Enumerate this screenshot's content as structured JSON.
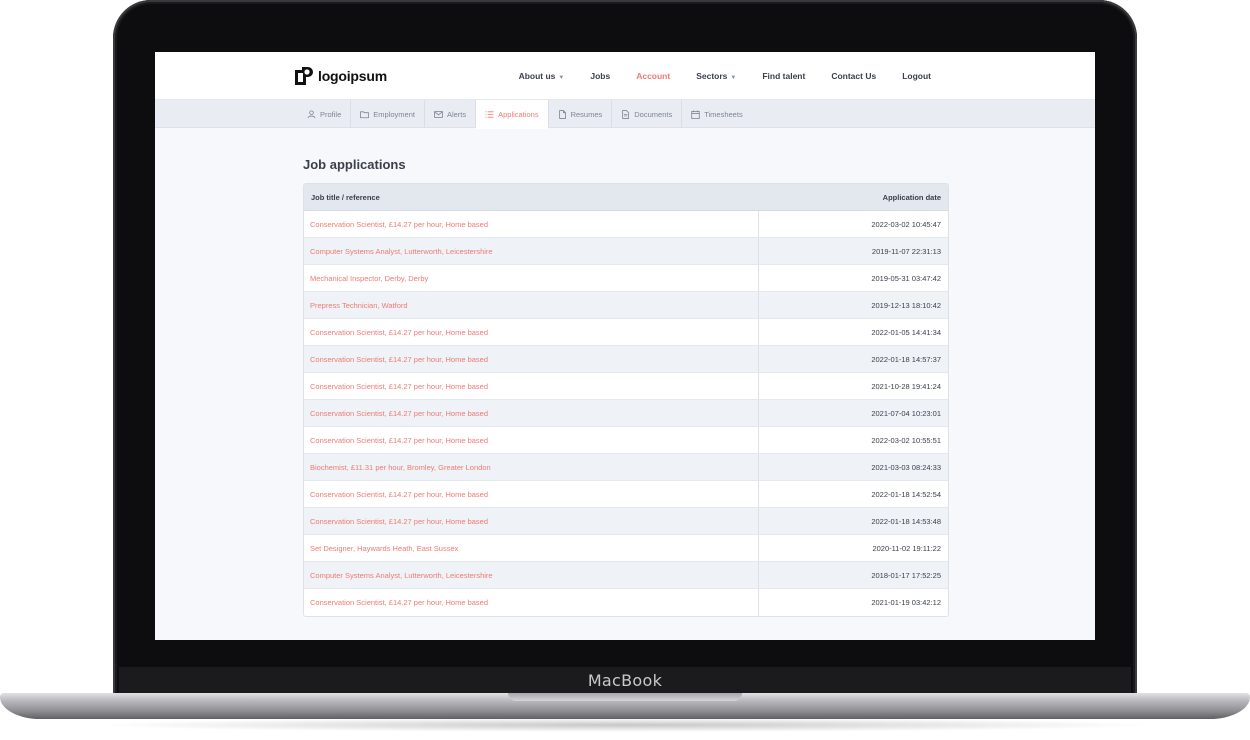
{
  "device": {
    "brand_label": "MacBook"
  },
  "site": {
    "logo_text": "logoipsum",
    "nav": [
      {
        "label": "About us",
        "has_dropdown": true,
        "active": false
      },
      {
        "label": "Jobs",
        "has_dropdown": false,
        "active": false
      },
      {
        "label": "Account",
        "has_dropdown": false,
        "active": true
      },
      {
        "label": "Sectors",
        "has_dropdown": true,
        "active": false
      },
      {
        "label": "Find talent",
        "has_dropdown": false,
        "active": false
      },
      {
        "label": "Contact Us",
        "has_dropdown": false,
        "active": false
      },
      {
        "label": "Logout",
        "has_dropdown": false,
        "active": false
      }
    ],
    "accent_color": "#ef7b74"
  },
  "account_tabs": [
    {
      "label": "Profile",
      "icon": "user-icon",
      "active": false
    },
    {
      "label": "Employment",
      "icon": "folder-icon",
      "active": false
    },
    {
      "label": "Alerts",
      "icon": "envelope-icon",
      "active": false
    },
    {
      "label": "Applications",
      "icon": "list-icon",
      "active": true
    },
    {
      "label": "Resumes",
      "icon": "file-icon",
      "active": false
    },
    {
      "label": "Documents",
      "icon": "document-icon",
      "active": false
    },
    {
      "label": "Timesheets",
      "icon": "calendar-icon",
      "active": false
    }
  ],
  "main": {
    "title": "Job applications",
    "columns": {
      "job_title": "Job title / reference",
      "application_date": "Application date"
    },
    "rows": [
      {
        "title": "Conservation Scientist, £14.27 per hour, Home based",
        "date": "2022-03-02 10:45:47"
      },
      {
        "title": "Computer Systems Analyst, Lutterworth, Leicestershire",
        "date": "2019-11-07 22:31:13"
      },
      {
        "title": "Mechanical Inspector, Derby, Derby",
        "date": "2019-05-31 03:47:42"
      },
      {
        "title": "Prepress Technician, Watford",
        "date": "2019-12-13 18:10:42"
      },
      {
        "title": "Conservation Scientist, £14.27 per hour, Home based",
        "date": "2022-01-05 14:41:34"
      },
      {
        "title": "Conservation Scientist, £14.27 per hour, Home based",
        "date": "2022-01-18 14:57:37"
      },
      {
        "title": "Conservation Scientist, £14.27 per hour, Home based",
        "date": "2021-10-28 19:41:24"
      },
      {
        "title": "Conservation Scientist, £14.27 per hour, Home based",
        "date": "2021-07-04 10:23:01"
      },
      {
        "title": "Conservation Scientist, £14.27 per hour, Home based",
        "date": "2022-03-02 10:55:51"
      },
      {
        "title": "Biochemist, £11.31 per hour, Bromley, Greater London",
        "date": "2021-03-03 08:24:33"
      },
      {
        "title": "Conservation Scientist, £14.27 per hour, Home based",
        "date": "2022-01-18 14:52:54"
      },
      {
        "title": "Conservation Scientist, £14.27 per hour, Home based",
        "date": "2022-01-18 14:53:48"
      },
      {
        "title": "Set Designer, Haywards Heath, East Sussex",
        "date": "2020-11-02 19:11:22"
      },
      {
        "title": "Computer Systems Analyst, Lutterworth, Leicestershire",
        "date": "2018-01-17 17:52:25"
      },
      {
        "title": "Conservation Scientist, £14.27 per hour, Home based",
        "date": "2021-01-19 03:42:12"
      }
    ]
  }
}
